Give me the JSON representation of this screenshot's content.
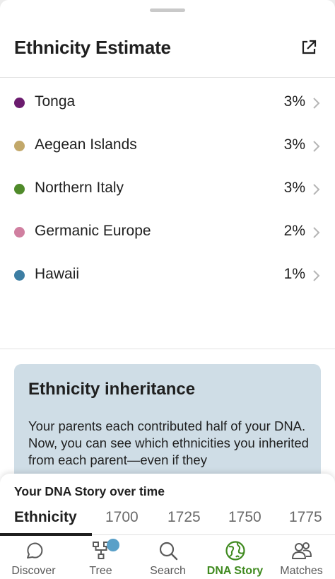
{
  "header": {
    "title": "Ethnicity Estimate"
  },
  "regions": [
    {
      "name": "Tonga",
      "percent": "3%",
      "color": "#6b1b6e"
    },
    {
      "name": "Aegean Islands",
      "percent": "3%",
      "color": "#c2a86a"
    },
    {
      "name": "Northern Italy",
      "percent": "3%",
      "color": "#4f8a2a"
    },
    {
      "name": "Germanic Europe",
      "percent": "2%",
      "color": "#d07fa0"
    },
    {
      "name": "Hawaii",
      "percent": "1%",
      "color": "#3d7ea3"
    }
  ],
  "card": {
    "title": "Ethnicity inheritance",
    "text": "Your parents each contributed half of your DNA. Now, you can see which ethnicities you inherited from each parent—even if they",
    "background": "#cfdde6"
  },
  "timeline": {
    "title": "Your DNA Story over time",
    "tabs": [
      "Ethnicity",
      "1700",
      "1725",
      "1750",
      "1775"
    ],
    "active_tab": "Ethnicity"
  },
  "nav": {
    "items": [
      {
        "label": "Discover",
        "icon": "discover-icon"
      },
      {
        "label": "Tree",
        "icon": "tree-icon"
      },
      {
        "label": "Search",
        "icon": "search-icon"
      },
      {
        "label": "DNA Story",
        "icon": "globe-icon"
      },
      {
        "label": "Matches",
        "icon": "people-icon"
      }
    ],
    "active": "DNA Story",
    "accent_color": "#3f8a1f"
  }
}
